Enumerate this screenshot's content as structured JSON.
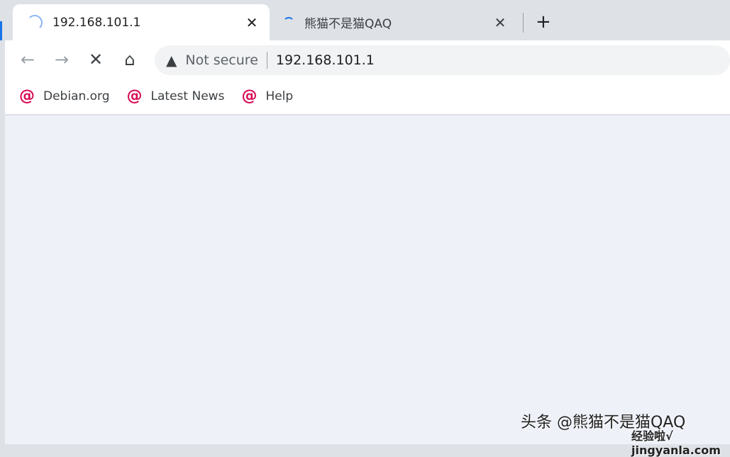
{
  "tabs": [
    {
      "title": "192.168.101.1",
      "active": true,
      "icon": "loading-spinner"
    },
    {
      "title": "熊猫不是猫QAQ",
      "active": false,
      "icon": "loading-spinner"
    }
  ],
  "new_tab_label": "+",
  "close_label": "✕",
  "toolbar": {
    "back": "←",
    "forward": "→",
    "stop": "✕",
    "home": "⌂"
  },
  "omnibox": {
    "security_label": "Not secure",
    "url": "192.168.101.1",
    "warning_icon": "▲"
  },
  "bookmarks": [
    {
      "label": "Debian.org"
    },
    {
      "label": "Latest News"
    },
    {
      "label": "Help"
    }
  ],
  "watermark": {
    "text": "头条 @熊猫不是猫QAQ",
    "overlay": "经验啦√ jingyanla.com"
  },
  "colors": {
    "accent": "#1a73e8",
    "debian": "#d70a53",
    "content_bg": "#eff1f9"
  }
}
